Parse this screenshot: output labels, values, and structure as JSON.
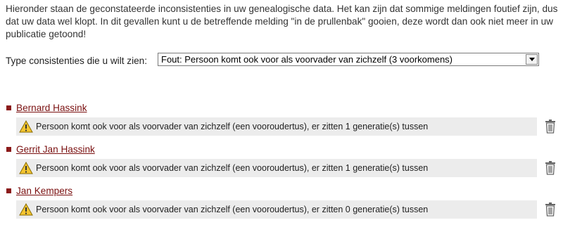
{
  "intro": {
    "text": "Hieronder staan de geconstateerde inconsistenties in uw genealogische data. Het kan zijn dat sommige meldingen foutief zijn, dus dat uw data wel klopt. In dit gevallen kunt u de betreffende melding \"in de prullenbak\" gooien, deze wordt dan ook niet meer in uw publicatie getoond!"
  },
  "filter": {
    "label": "Type consistenties die u wilt zien:",
    "selected": "Fout: Persoon komt ook voor als voorvader van zichzelf (3 voorkomens)"
  },
  "items": [
    {
      "name": "Bernard Hassink",
      "message": "Persoon komt ook voor als voorvader van zichzelf (een vooroudertus), er zitten 1 generatie(s) tussen"
    },
    {
      "name": "Gerrit Jan Hassink",
      "message": "Persoon komt ook voor als voorvader van zichzelf (een vooroudertus), er zitten 1 generatie(s) tussen"
    },
    {
      "name": "Jan Kempers",
      "message": "Persoon komt ook voor als voorvader van zichzelf (een vooroudertus), er zitten 0 generatie(s) tussen"
    }
  ],
  "icons": {
    "warning": "warning-icon",
    "trash": "trash-icon",
    "bullet_color": "#8b1a1a",
    "link_color": "#7a1010",
    "message_bg": "#ececec"
  }
}
